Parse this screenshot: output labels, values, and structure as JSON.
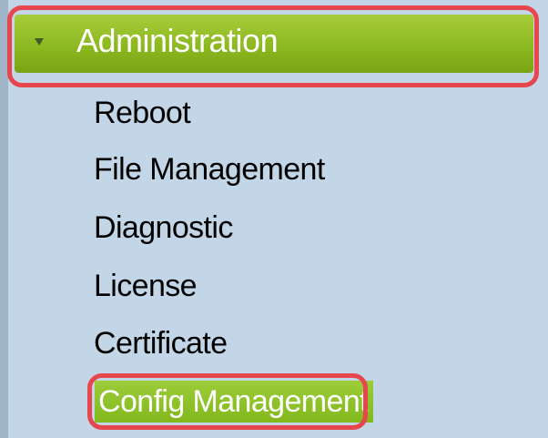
{
  "menu": {
    "section_title": "Administration",
    "items": [
      {
        "label": "Reboot"
      },
      {
        "label": "File Management"
      },
      {
        "label": "Diagnostic"
      },
      {
        "label": "License"
      },
      {
        "label": "Certificate"
      },
      {
        "label": "Config Management"
      }
    ],
    "active_item": "Config Management"
  },
  "colors": {
    "panel_background": "#c2d6e8",
    "header_green": "#8cb820",
    "highlight_outline": "#e8464f",
    "text_dark": "#000000",
    "text_light": "#ffffff"
  },
  "icons": {
    "section_toggle": "triangle-down-icon"
  }
}
